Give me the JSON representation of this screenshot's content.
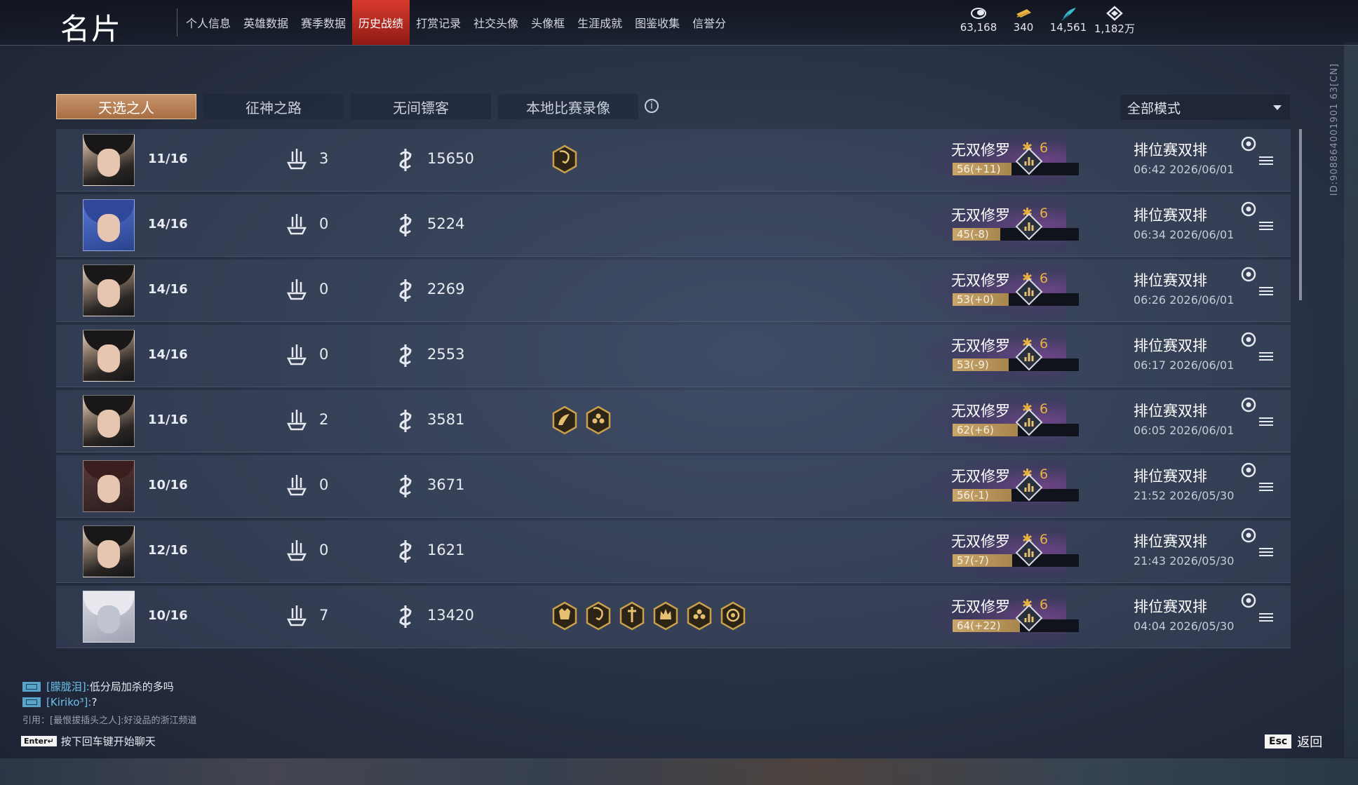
{
  "header": {
    "title": "名片",
    "nav": [
      {
        "label": "个人信息",
        "badge": true
      },
      {
        "label": "英雄数据"
      },
      {
        "label": "赛季数据"
      },
      {
        "label": "历史战绩",
        "active": true
      },
      {
        "label": "打赏记录"
      },
      {
        "label": "社交头像"
      },
      {
        "label": "头像框"
      },
      {
        "label": "生涯成就"
      },
      {
        "label": "图鉴收集"
      },
      {
        "label": "信誉分"
      }
    ],
    "currencies": [
      {
        "icon": "gold-coin-icon",
        "value": "63,168"
      },
      {
        "icon": "ticket-icon",
        "value": "340"
      },
      {
        "icon": "feather-icon",
        "value": "14,561"
      },
      {
        "icon": "diamond-icon",
        "value": "1,182万"
      }
    ]
  },
  "mode_tabs": [
    {
      "label": "天选之人",
      "active": true
    },
    {
      "label": "征神之路"
    },
    {
      "label": "无间镖客"
    },
    {
      "label": "本地比赛录像"
    }
  ],
  "filter": {
    "selected": "全部模式"
  },
  "side_id": "ID:908864001901 63[CN]",
  "matches": [
    {
      "avatar": "hero-brown-hair",
      "placement": "11/16",
      "kills": "3",
      "damage": "15650",
      "medals": [
        "skull-medal-icon"
      ],
      "rank": "无双修罗",
      "rank_level": "6",
      "points": "56(+11)",
      "points_fill": 0.56,
      "mode": "排位赛双排",
      "time": "06:42  2026/06/01"
    },
    {
      "avatar": "hero-hood",
      "placement": "14/16",
      "kills": "0",
      "damage": "5224",
      "medals": [],
      "rank": "无双修罗",
      "rank_level": "6",
      "points": "45(-8)",
      "points_fill": 0.45,
      "mode": "排位赛双排",
      "time": "06:34  2026/06/01"
    },
    {
      "avatar": "hero-dark-hair",
      "placement": "14/16",
      "kills": "0",
      "damage": "2269",
      "medals": [],
      "rank": "无双修罗",
      "rank_level": "6",
      "points": "53(+0)",
      "points_fill": 0.53,
      "mode": "排位赛双排",
      "time": "06:26  2026/06/01"
    },
    {
      "avatar": "hero-dark-hair",
      "placement": "14/16",
      "kills": "0",
      "damage": "2553",
      "medals": [],
      "rank": "无双修罗",
      "rank_level": "6",
      "points": "53(-9)",
      "points_fill": 0.53,
      "mode": "排位赛双排",
      "time": "06:17  2026/06/01"
    },
    {
      "avatar": "hero-dark-hair",
      "placement": "11/16",
      "kills": "2",
      "damage": "3581",
      "medals": [
        "dragon-medal-icon",
        "flower-medal-icon"
      ],
      "rank": "无双修罗",
      "rank_level": "6",
      "points": "62(+6)",
      "points_fill": 0.62,
      "mode": "排位赛双排",
      "time": "06:05  2026/06/01"
    },
    {
      "avatar": "hero-female",
      "placement": "10/16",
      "kills": "0",
      "damage": "3671",
      "medals": [],
      "rank": "无双修罗",
      "rank_level": "6",
      "points": "56(-1)",
      "points_fill": 0.56,
      "mode": "排位赛双排",
      "time": "21:52  2026/05/30"
    },
    {
      "avatar": "hero-dark-hair",
      "placement": "12/16",
      "kills": "0",
      "damage": "1621",
      "medals": [],
      "rank": "无双修罗",
      "rank_level": "6",
      "points": "57(-7)",
      "points_fill": 0.57,
      "mode": "排位赛双排",
      "time": "21:43  2026/05/30"
    },
    {
      "avatar": "hero-mask",
      "placement": "10/16",
      "kills": "7",
      "damage": "13420",
      "medals": [
        "demon-medal-icon",
        "skull-medal-icon",
        "sword-medal-icon",
        "crown-medal-icon",
        "flower-medal-icon",
        "lion-medal-icon"
      ],
      "rank": "无双修罗",
      "rank_level": "6",
      "points": "64(+22)",
      "points_fill": 0.64,
      "mode": "排位赛双排",
      "time": "04:04  2026/05/30"
    }
  ],
  "chat": {
    "messages": [
      {
        "name": "[朦胧泪]:",
        "text": "低分局加杀的多吗"
      },
      {
        "name": "[Kiriko³]:",
        "text": "?"
      }
    ],
    "quote": "引用：[最恨拔插头之人]:好没品的浙江频道",
    "enter_key": "Enter↵",
    "hint": "按下回车键开始聊天"
  },
  "footer": {
    "esc_key": "Esc",
    "back_label": "返回"
  }
}
